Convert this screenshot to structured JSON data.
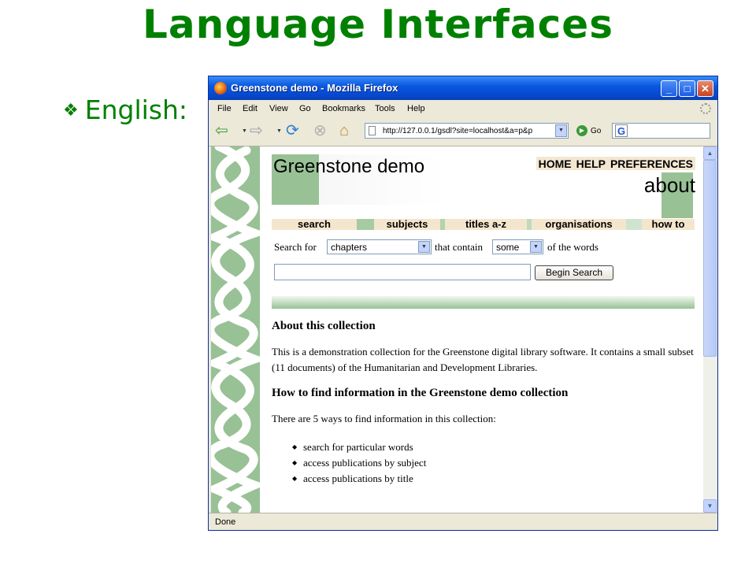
{
  "slide": {
    "title": "Language Interfaces",
    "bullet": "English:"
  },
  "window": {
    "title": "Greenstone demo - Mozilla Firefox",
    "menu": [
      "File",
      "Edit",
      "View",
      "Go",
      "Bookmarks",
      "Tools",
      "Help"
    ],
    "url": "http://127.0.0.1/gsdl?site=localhost&a=p&p",
    "go_label": "Go",
    "status": "Done"
  },
  "page": {
    "logo": "Greenstone demo",
    "top_nav": [
      "HOME",
      "HELP",
      "PREFERENCES"
    ],
    "section": "about",
    "tabs": [
      "search",
      "subjects",
      "titles a-z",
      "organisations",
      "how to"
    ],
    "search": {
      "prefix": "Search for",
      "scope": "chapters",
      "middle": "that contain",
      "mode": "some",
      "suffix": "of the words",
      "query": "",
      "button": "Begin Search"
    },
    "about_heading": "About this collection",
    "about_text": "This is a demonstration collection for the Greenstone digital library software. It contains a small subset (11 documents) of the Humanitarian and Development Libraries.",
    "howto_heading": "How to find information in the Greenstone demo collection",
    "howto_intro": "There are 5 ways to find information in this collection:",
    "ways": [
      "search for particular words",
      "access publications by subject",
      "access publications by title"
    ]
  },
  "colors": {
    "title_green": "#008000",
    "sidebar_green": "#98c196",
    "tab_beige": "#f4e6cd",
    "titlebar_blue": "#0a58e0"
  }
}
